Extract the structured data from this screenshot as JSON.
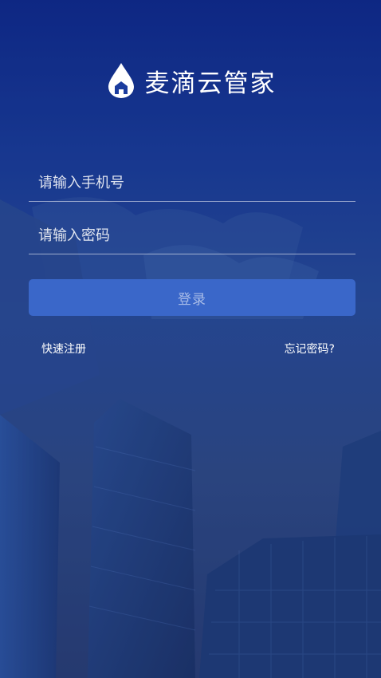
{
  "app": {
    "title": "麦滴云管家"
  },
  "login": {
    "phone_placeholder": "请输入手机号",
    "password_placeholder": "请输入密码",
    "button_label": "登录"
  },
  "links": {
    "register": "快速注册",
    "forgot": "忘记密码?"
  },
  "colors": {
    "top": "#0f2a8c",
    "button": "#3a67c9"
  }
}
